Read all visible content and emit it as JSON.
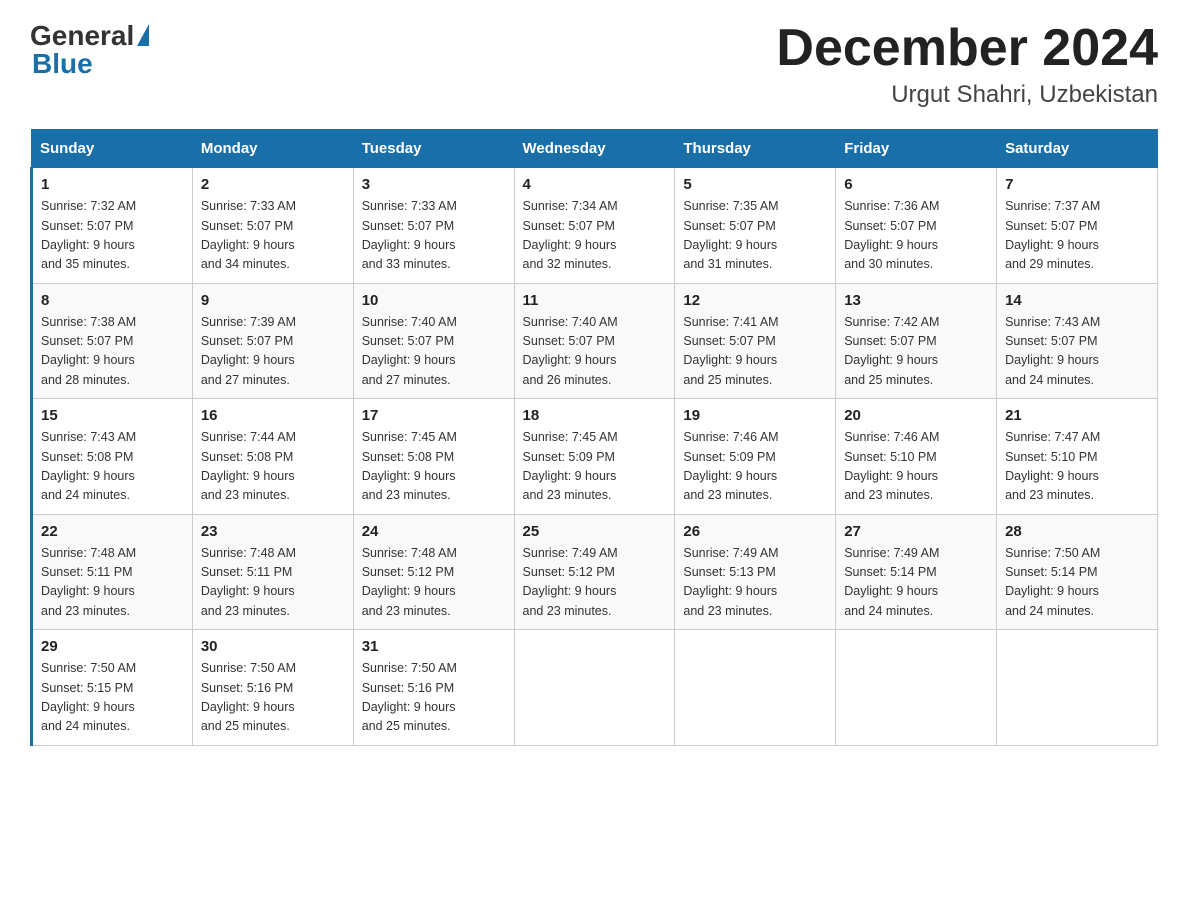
{
  "header": {
    "logo_general": "General",
    "logo_blue": "Blue",
    "month_year": "December 2024",
    "location": "Urgut Shahri, Uzbekistan"
  },
  "days_of_week": [
    "Sunday",
    "Monday",
    "Tuesday",
    "Wednesday",
    "Thursday",
    "Friday",
    "Saturday"
  ],
  "weeks": [
    [
      {
        "day": "1",
        "sunrise": "7:32 AM",
        "sunset": "5:07 PM",
        "daylight": "9 hours and 35 minutes."
      },
      {
        "day": "2",
        "sunrise": "7:33 AM",
        "sunset": "5:07 PM",
        "daylight": "9 hours and 34 minutes."
      },
      {
        "day": "3",
        "sunrise": "7:33 AM",
        "sunset": "5:07 PM",
        "daylight": "9 hours and 33 minutes."
      },
      {
        "day": "4",
        "sunrise": "7:34 AM",
        "sunset": "5:07 PM",
        "daylight": "9 hours and 32 minutes."
      },
      {
        "day": "5",
        "sunrise": "7:35 AM",
        "sunset": "5:07 PM",
        "daylight": "9 hours and 31 minutes."
      },
      {
        "day": "6",
        "sunrise": "7:36 AM",
        "sunset": "5:07 PM",
        "daylight": "9 hours and 30 minutes."
      },
      {
        "day": "7",
        "sunrise": "7:37 AM",
        "sunset": "5:07 PM",
        "daylight": "9 hours and 29 minutes."
      }
    ],
    [
      {
        "day": "8",
        "sunrise": "7:38 AM",
        "sunset": "5:07 PM",
        "daylight": "9 hours and 28 minutes."
      },
      {
        "day": "9",
        "sunrise": "7:39 AM",
        "sunset": "5:07 PM",
        "daylight": "9 hours and 27 minutes."
      },
      {
        "day": "10",
        "sunrise": "7:40 AM",
        "sunset": "5:07 PM",
        "daylight": "9 hours and 27 minutes."
      },
      {
        "day": "11",
        "sunrise": "7:40 AM",
        "sunset": "5:07 PM",
        "daylight": "9 hours and 26 minutes."
      },
      {
        "day": "12",
        "sunrise": "7:41 AM",
        "sunset": "5:07 PM",
        "daylight": "9 hours and 25 minutes."
      },
      {
        "day": "13",
        "sunrise": "7:42 AM",
        "sunset": "5:07 PM",
        "daylight": "9 hours and 25 minutes."
      },
      {
        "day": "14",
        "sunrise": "7:43 AM",
        "sunset": "5:07 PM",
        "daylight": "9 hours and 24 minutes."
      }
    ],
    [
      {
        "day": "15",
        "sunrise": "7:43 AM",
        "sunset": "5:08 PM",
        "daylight": "9 hours and 24 minutes."
      },
      {
        "day": "16",
        "sunrise": "7:44 AM",
        "sunset": "5:08 PM",
        "daylight": "9 hours and 23 minutes."
      },
      {
        "day": "17",
        "sunrise": "7:45 AM",
        "sunset": "5:08 PM",
        "daylight": "9 hours and 23 minutes."
      },
      {
        "day": "18",
        "sunrise": "7:45 AM",
        "sunset": "5:09 PM",
        "daylight": "9 hours and 23 minutes."
      },
      {
        "day": "19",
        "sunrise": "7:46 AM",
        "sunset": "5:09 PM",
        "daylight": "9 hours and 23 minutes."
      },
      {
        "day": "20",
        "sunrise": "7:46 AM",
        "sunset": "5:10 PM",
        "daylight": "9 hours and 23 minutes."
      },
      {
        "day": "21",
        "sunrise": "7:47 AM",
        "sunset": "5:10 PM",
        "daylight": "9 hours and 23 minutes."
      }
    ],
    [
      {
        "day": "22",
        "sunrise": "7:48 AM",
        "sunset": "5:11 PM",
        "daylight": "9 hours and 23 minutes."
      },
      {
        "day": "23",
        "sunrise": "7:48 AM",
        "sunset": "5:11 PM",
        "daylight": "9 hours and 23 minutes."
      },
      {
        "day": "24",
        "sunrise": "7:48 AM",
        "sunset": "5:12 PM",
        "daylight": "9 hours and 23 minutes."
      },
      {
        "day": "25",
        "sunrise": "7:49 AM",
        "sunset": "5:12 PM",
        "daylight": "9 hours and 23 minutes."
      },
      {
        "day": "26",
        "sunrise": "7:49 AM",
        "sunset": "5:13 PM",
        "daylight": "9 hours and 23 minutes."
      },
      {
        "day": "27",
        "sunrise": "7:49 AM",
        "sunset": "5:14 PM",
        "daylight": "9 hours and 24 minutes."
      },
      {
        "day": "28",
        "sunrise": "7:50 AM",
        "sunset": "5:14 PM",
        "daylight": "9 hours and 24 minutes."
      }
    ],
    [
      {
        "day": "29",
        "sunrise": "7:50 AM",
        "sunset": "5:15 PM",
        "daylight": "9 hours and 24 minutes."
      },
      {
        "day": "30",
        "sunrise": "7:50 AM",
        "sunset": "5:16 PM",
        "daylight": "9 hours and 25 minutes."
      },
      {
        "day": "31",
        "sunrise": "7:50 AM",
        "sunset": "5:16 PM",
        "daylight": "9 hours and 25 minutes."
      },
      null,
      null,
      null,
      null
    ]
  ],
  "labels": {
    "sunrise": "Sunrise:",
    "sunset": "Sunset:",
    "daylight": "Daylight:"
  }
}
